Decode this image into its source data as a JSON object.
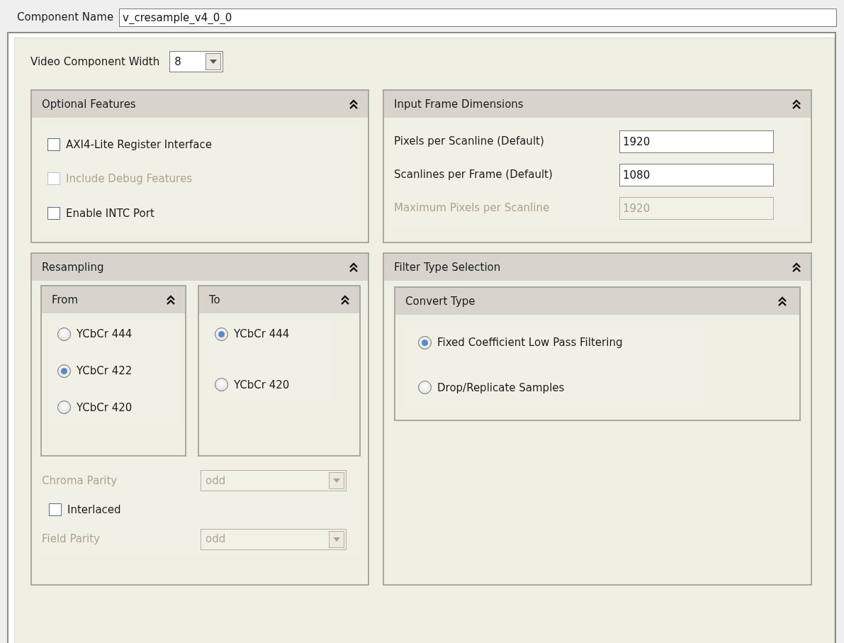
{
  "component_name": {
    "label": "Component Name",
    "value": "v_cresample_v4_0_0"
  },
  "video_component_width": {
    "label": "Video Component Width",
    "value": "8"
  },
  "optional_features": {
    "title": "Optional Features",
    "checkboxes": [
      {
        "label": "AXI4-Lite Register Interface",
        "checked": false,
        "disabled": false
      },
      {
        "label": "Include Debug Features",
        "checked": false,
        "disabled": true
      },
      {
        "label": "Enable INTC Port",
        "checked": false,
        "disabled": false
      }
    ]
  },
  "input_frame_dimensions": {
    "title": "Input Frame Dimensions",
    "fields": [
      {
        "label": "Pixels per Scanline (Default)",
        "value": "1920",
        "disabled": false
      },
      {
        "label": "Scanlines per Frame (Default)",
        "value": "1080",
        "disabled": false
      },
      {
        "label": "Maximum Pixels per Scanline",
        "value": "1920",
        "disabled": true
      }
    ]
  },
  "resampling": {
    "title": "Resampling",
    "from": {
      "title": "From",
      "options": [
        {
          "label": "YCbCr 444",
          "selected": false
        },
        {
          "label": "YCbCr 422",
          "selected": true
        },
        {
          "label": "YCbCr 420",
          "selected": false
        }
      ]
    },
    "to": {
      "title": "To",
      "options": [
        {
          "label": "YCbCr 444",
          "selected": true
        },
        {
          "label": "YCbCr 420",
          "selected": false
        }
      ]
    },
    "chroma_parity": {
      "label": "Chroma Parity",
      "value": "odd",
      "disabled": true
    },
    "interlaced": {
      "label": "Interlaced",
      "checked": false
    },
    "field_parity": {
      "label": "Field Parity",
      "value": "odd",
      "disabled": true
    }
  },
  "filter_type_selection": {
    "title": "Filter Type Selection",
    "convert_type": {
      "title": "Convert Type",
      "options": [
        {
          "label": "Fixed Coefficient Low Pass Filtering",
          "selected": true
        },
        {
          "label": "Drop/Replicate Samples",
          "selected": false
        }
      ]
    }
  }
}
